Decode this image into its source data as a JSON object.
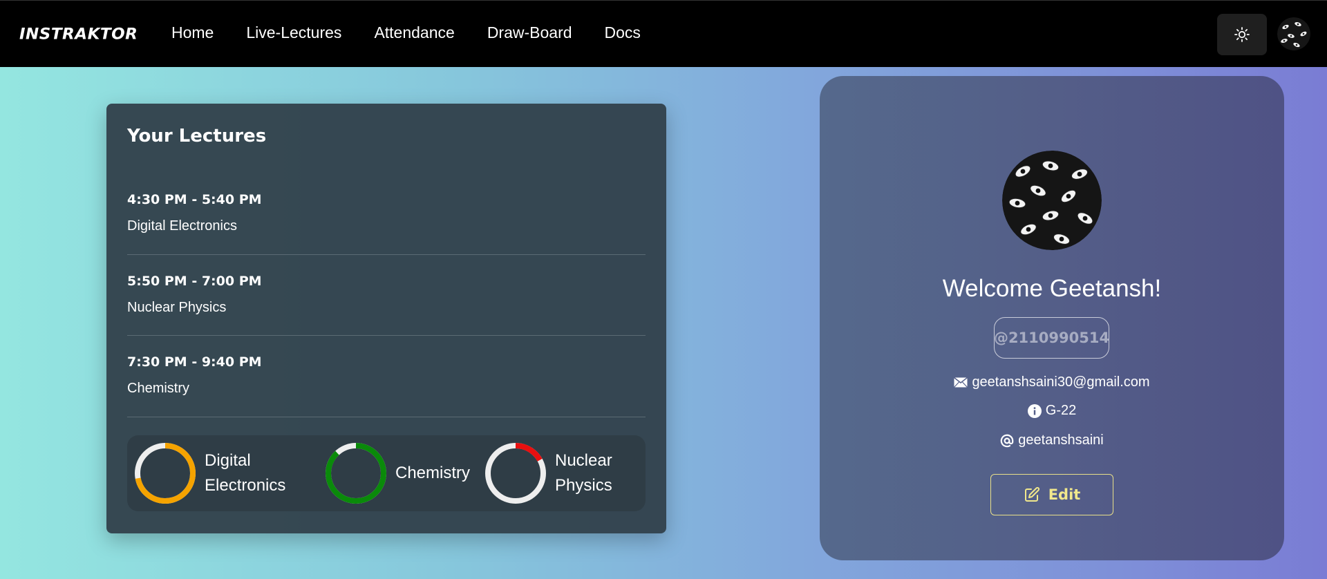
{
  "nav": {
    "logo": "INSTRAKTOR",
    "links": [
      "Home",
      "Live-Lectures",
      "Attendance",
      "Draw-Board",
      "Docs"
    ],
    "theme_icon": "sun-icon",
    "avatar_icon": "eyes-pattern-avatar"
  },
  "lectures": {
    "title": "Your Lectures",
    "items": [
      {
        "time": "4:30 PM - 5:40 PM",
        "subject": "Digital Electronics"
      },
      {
        "time": "5:50 PM - 7:00 PM",
        "subject": "Nuclear Physics"
      },
      {
        "time": "7:30 PM - 9:40 PM",
        "subject": "Chemistry"
      }
    ],
    "progress": [
      {
        "label_line1": "Digital",
        "label_line2": "Electronics",
        "fraction": 0.72,
        "color": "#f5a300"
      },
      {
        "label_line1": "Chemistry",
        "label_line2": "",
        "fraction": 0.88,
        "color": "#0a8a0a"
      },
      {
        "label_line1": "Nuclear",
        "label_line2": "Physics",
        "fraction": 0.17,
        "color": "#e81010"
      }
    ],
    "ring_track_color": "#eeeeee"
  },
  "profile": {
    "welcome": "Welcome Geetansh!",
    "username": "@2110990514",
    "email": "geetanshsaini30@gmail.com",
    "group": "G-22",
    "handle": "geetanshsaini",
    "edit_label": "Edit",
    "email_icon": "mail-icon",
    "group_icon": "info-icon",
    "handle_icon": "at-icon",
    "edit_icon": "edit-icon"
  }
}
